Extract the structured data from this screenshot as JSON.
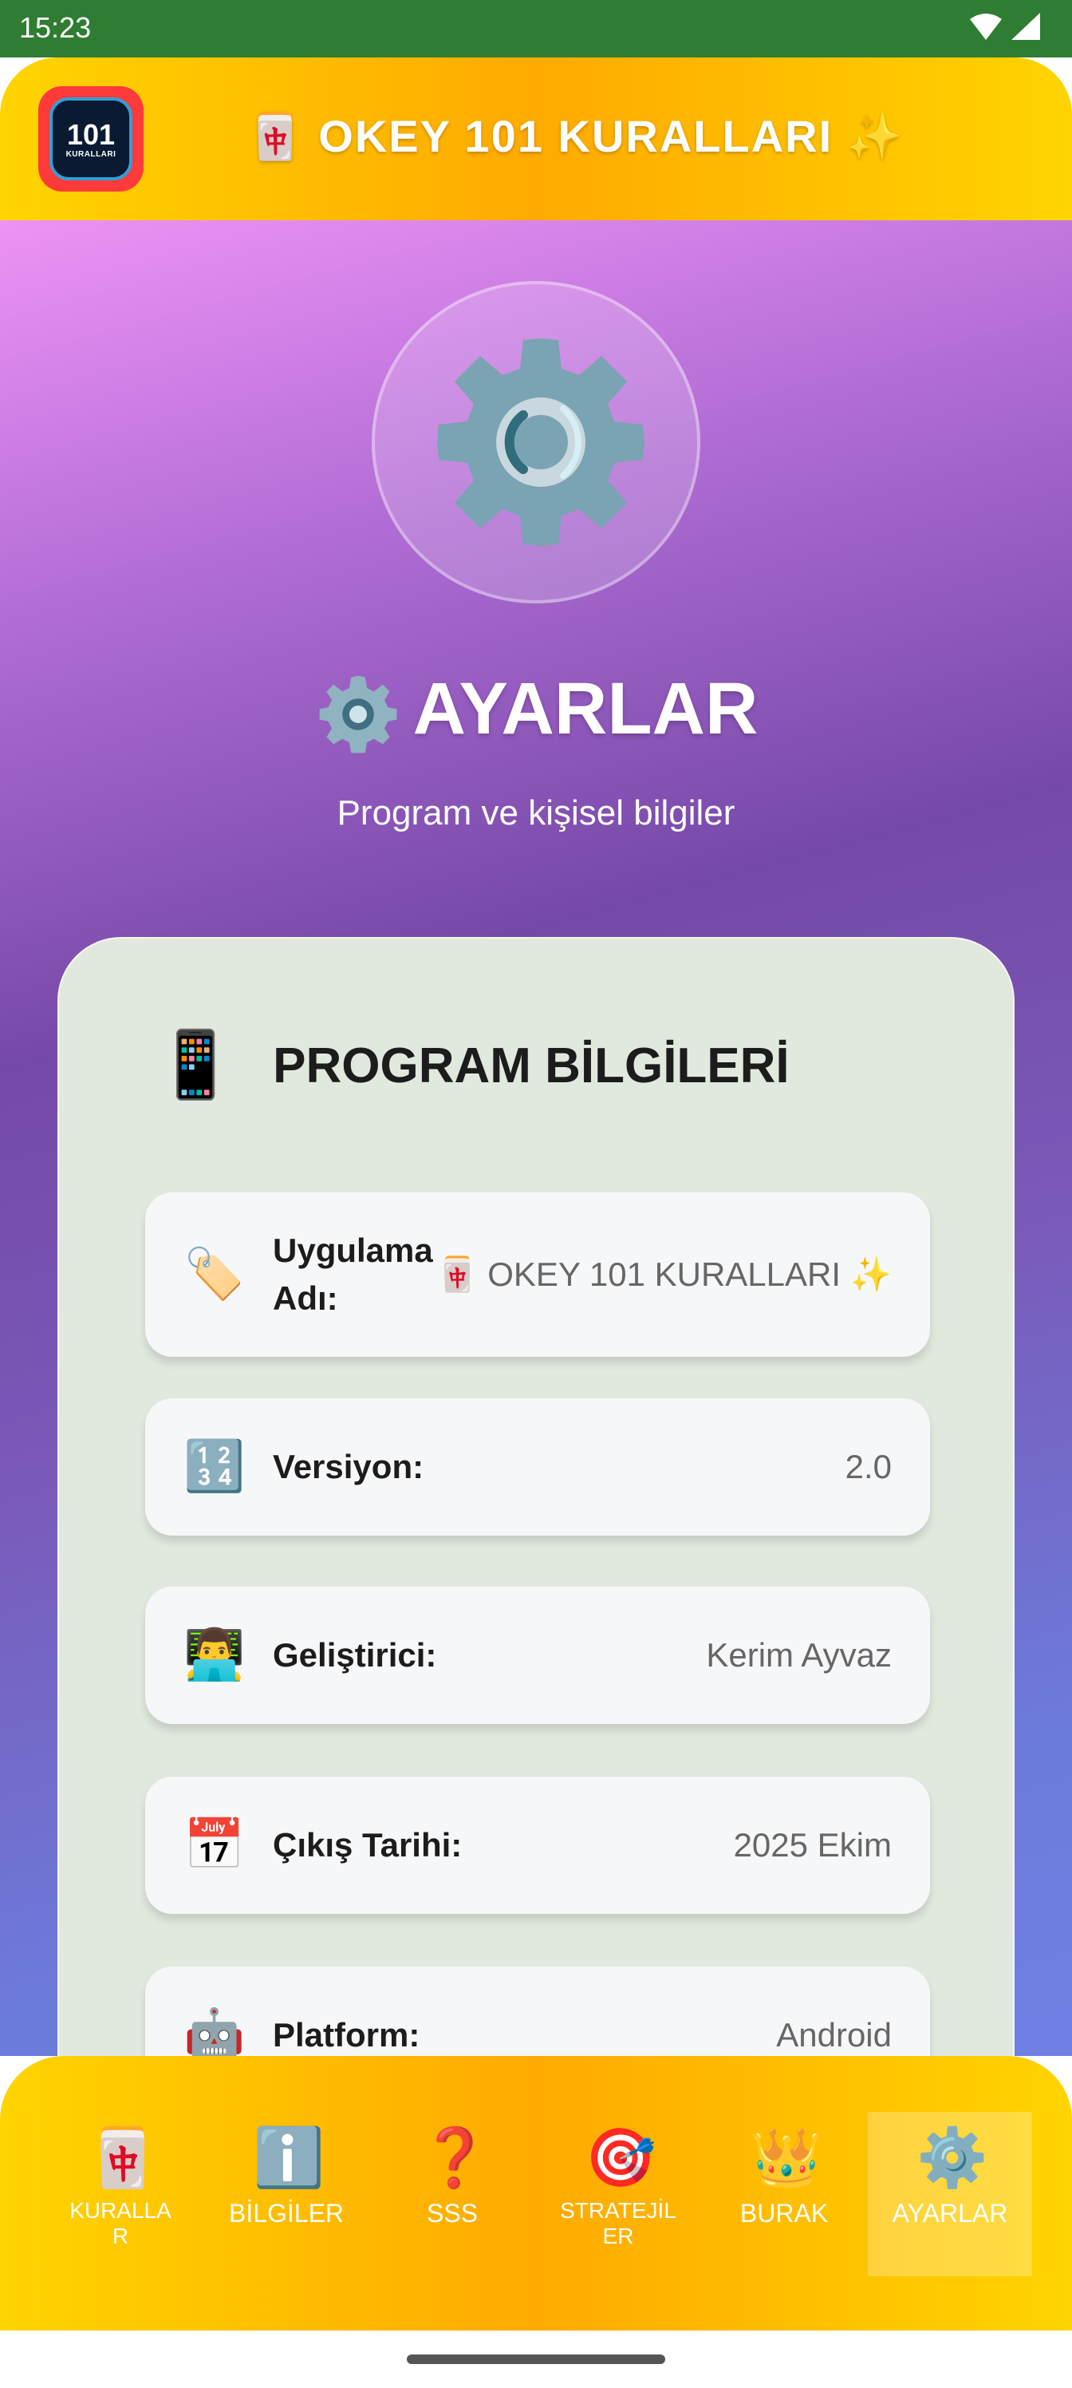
{
  "status_bar": {
    "time": "15:23"
  },
  "header": {
    "logo_number": "101",
    "logo_subtitle": "KURALLARI",
    "title": "🀄 OKEY 101 KURALLARI ✨"
  },
  "hero": {
    "title": "AYARLAR",
    "subtitle": "Program ve kişisel bilgiler"
  },
  "info_card": {
    "title_icon": "📱",
    "title": "PROGRAM BİLGİLERİ",
    "rows": [
      {
        "icon": "🏷️",
        "label_line1": "Uygulama",
        "label_line2": "Adı:",
        "value": "🀄 OKEY 101 KURALLARI ✨"
      },
      {
        "icon": "🔢",
        "label": "Versiyon:",
        "value": "2.0"
      },
      {
        "icon": "👨‍💻",
        "label": "Geliştirici:",
        "value": "Kerim Ayvaz"
      },
      {
        "icon": "📅",
        "label": "Çıkış Tarihi:",
        "value": "2025 Ekim"
      },
      {
        "icon": "🤖",
        "label": "Platform:",
        "value": "Android"
      }
    ]
  },
  "bottom_nav": {
    "items": [
      {
        "icon": "🀄",
        "label": "KURALLA\nR"
      },
      {
        "icon": "ℹ️",
        "label": "BİLGİLER"
      },
      {
        "icon": "❓",
        "label": "SSS"
      },
      {
        "icon": "🎯",
        "label": "STRATEJİL\nER"
      },
      {
        "icon": "👑",
        "label": "BURAK"
      },
      {
        "icon": "⚙️",
        "label": "AYARLAR"
      }
    ],
    "active_index": 5
  },
  "colors": {
    "status_bar": "#2e7d32",
    "header_yellow": "#ffd400",
    "header_orange": "#ffaa00",
    "gear": "#7aa3b3",
    "card_bg": "#e1e9de"
  }
}
